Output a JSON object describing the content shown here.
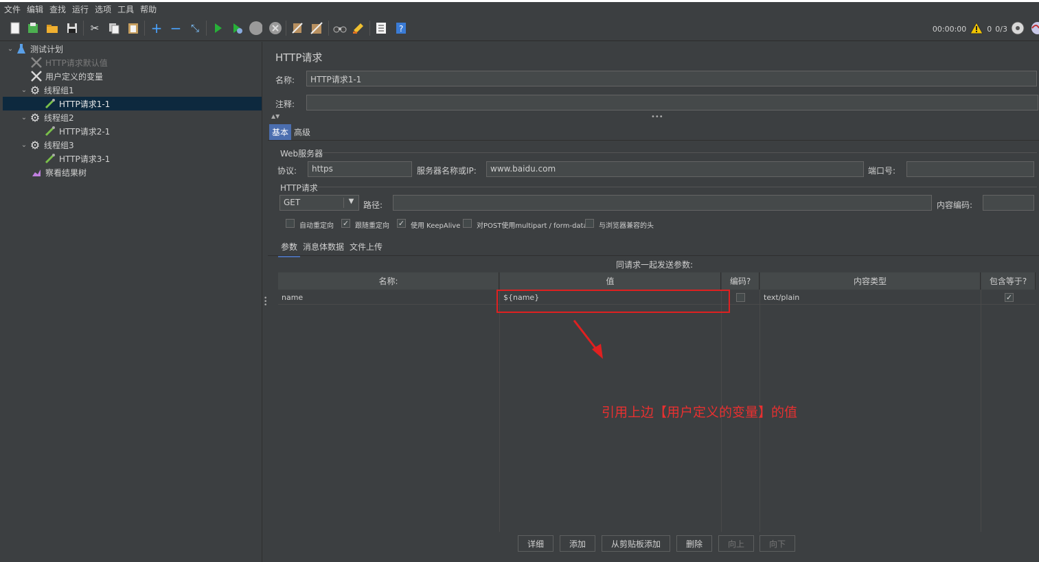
{
  "menu": [
    "文件",
    "编辑",
    "查找",
    "运行",
    "选项",
    "工具",
    "帮助"
  ],
  "toolbar": {
    "icons": [
      "new-icon",
      "templates-icon",
      "open-icon",
      "save-icon",
      "cut-icon",
      "copy-icon",
      "paste-icon",
      "expand-icon",
      "collapse-icon",
      "toggle-icon",
      "start-icon",
      "start-no-pause-icon",
      "stop-icon",
      "shutdown-icon",
      "clear-icon",
      "clear-all-icon",
      "search-icon",
      "reset-search-icon",
      "function-helper-icon",
      "help-icon"
    ],
    "timer": "00:00:00",
    "warnings": "0",
    "threads": "0/3"
  },
  "tree": [
    {
      "label": "测试计划",
      "icon": "flask-icon",
      "expand": "⌄",
      "level": 0
    },
    {
      "label": "HTTP请求默认值",
      "icon": "wrench-icon",
      "level": 1,
      "disabled": true
    },
    {
      "label": "用户定义的变量",
      "icon": "wrench-icon",
      "level": 1
    },
    {
      "label": "线程组1",
      "icon": "gear-icon",
      "expand": "⌄",
      "level": 1
    },
    {
      "label": "HTTP请求1-1",
      "icon": "pipette-icon",
      "level": 2,
      "selected": true
    },
    {
      "label": "线程组2",
      "icon": "gear-icon",
      "expand": "⌄",
      "level": 1
    },
    {
      "label": "HTTP请求2-1",
      "icon": "pipette-icon",
      "level": 2
    },
    {
      "label": "线程组3",
      "icon": "gear-icon",
      "expand": "⌄",
      "level": 1
    },
    {
      "label": "HTTP请求3-1",
      "icon": "pipette-icon",
      "level": 2
    },
    {
      "label": "察看结果树",
      "icon": "chart-icon",
      "level": 1
    }
  ],
  "panel": {
    "title": "HTTP请求",
    "name_label": "名称:",
    "name_value": "HTTP请求1-1",
    "comment_label": "注释:",
    "comment_value": "",
    "tabs": [
      "基本",
      "高级"
    ],
    "web_server_section": "Web服务器",
    "protocol_label": "协议:",
    "protocol_value": "https",
    "server_label": "服务器名称或IP:",
    "server_value": "www.baidu.com",
    "port_label": "端口号:",
    "port_value": "",
    "http_section": "HTTP请求",
    "method_value": "GET",
    "path_label": "路径:",
    "path_value": "",
    "encoding_label": "内容编码:",
    "encoding_value": "",
    "checkboxes": [
      {
        "label": "自动重定向",
        "checked": false
      },
      {
        "label": "跟随重定向",
        "checked": true
      },
      {
        "label": "使用 KeepAlive",
        "checked": true
      },
      {
        "label": "对POST使用multipart / form-data",
        "checked": false
      },
      {
        "label": "与浏览器兼容的头",
        "checked": false
      }
    ],
    "subtabs": [
      "参数",
      "消息体数据",
      "文件上传"
    ],
    "params_caption": "同请求一起发送参数:",
    "table_headers": [
      "名称:",
      "值",
      "编码?",
      "内容类型",
      "包含等于?"
    ],
    "rows": [
      {
        "name": "name",
        "value": "${name}",
        "encode": false,
        "content_type": "text/plain",
        "include_equals": true
      }
    ],
    "buttons": [
      {
        "label": "详细",
        "enabled": true
      },
      {
        "label": "添加",
        "enabled": true
      },
      {
        "label": "从剪贴板添加",
        "enabled": true
      },
      {
        "label": "删除",
        "enabled": true
      },
      {
        "label": "向上",
        "enabled": false
      },
      {
        "label": "向下",
        "enabled": false
      }
    ]
  },
  "annotation": "引用上边【用户定义的变量】的值",
  "colors": {
    "selection": "#0d293e",
    "accent": "#4b6eaf",
    "annotation": "#e02020"
  }
}
